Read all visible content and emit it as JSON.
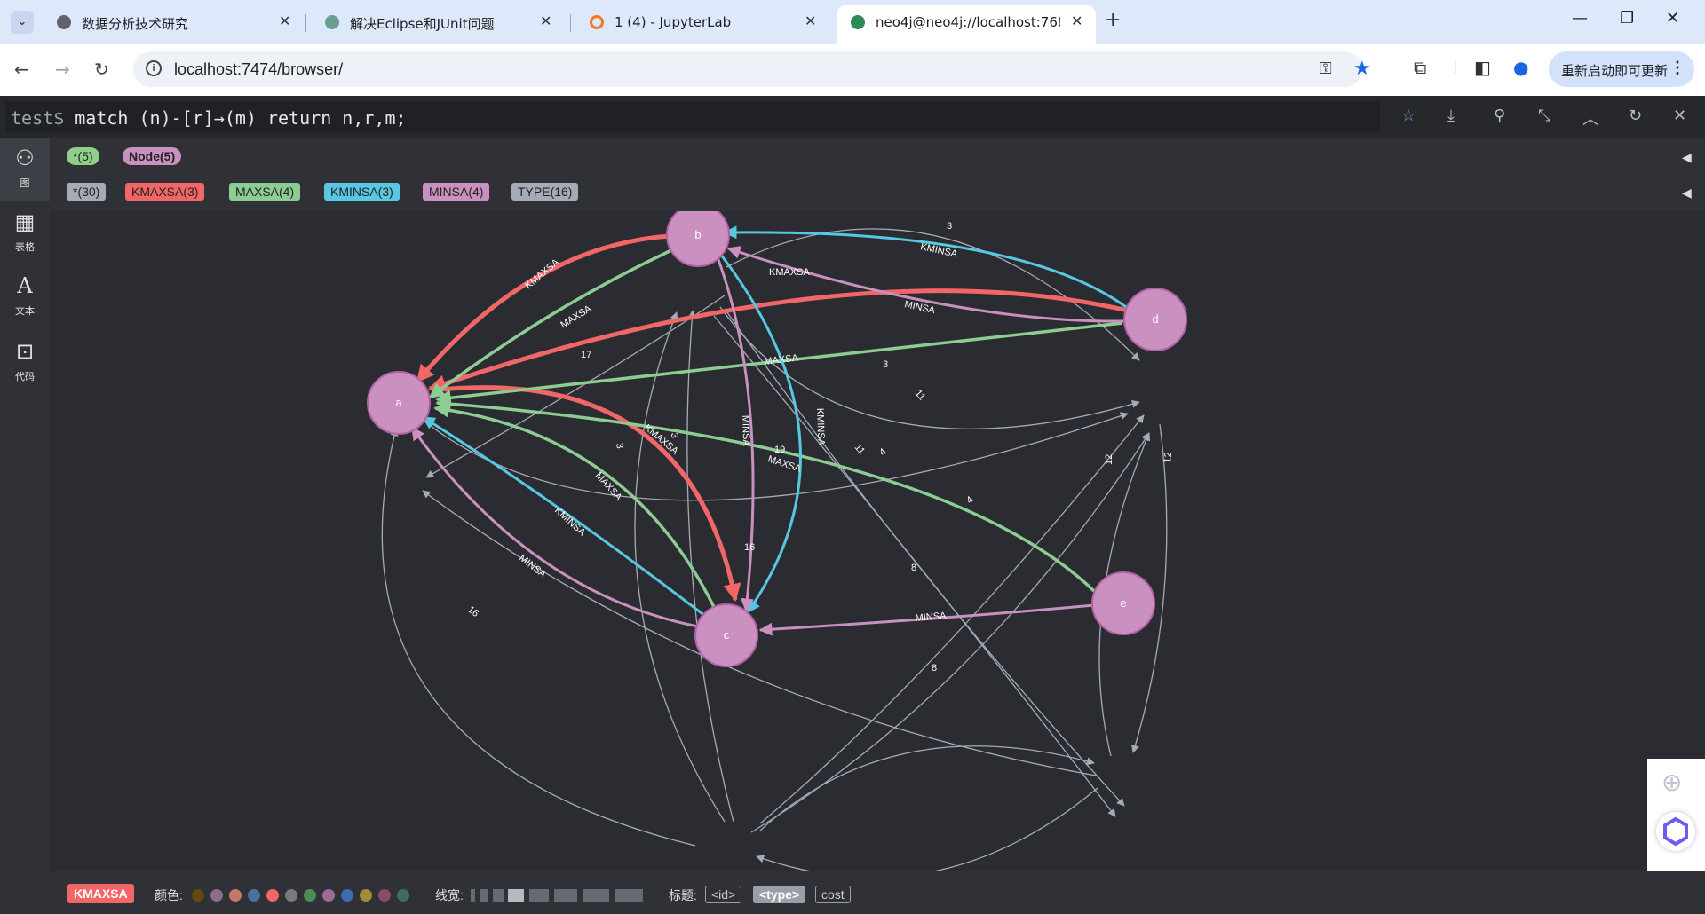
{
  "browser": {
    "tabs": [
      {
        "title": "数据分析技术研究",
        "active": false
      },
      {
        "title": "解决Eclipse和JUnit问题",
        "active": false
      },
      {
        "title": "1 (4) - JupyterLab",
        "active": false
      },
      {
        "title": "neo4j@neo4j://localhost:768",
        "active": true
      }
    ],
    "url": "localhost:7474/browser/",
    "update_button": "重新启动即可更新"
  },
  "editor": {
    "prompt": "test$",
    "query": "match (n)-[r]→(m) return n,r,m;"
  },
  "leftnav": [
    {
      "label": "图",
      "icon": "graph-icon"
    },
    {
      "label": "表格",
      "icon": "table-icon"
    },
    {
      "label": "文本",
      "icon": "text-icon"
    },
    {
      "label": "代码",
      "icon": "code-icon"
    }
  ],
  "legend": {
    "nodes": [
      {
        "label": "*(5)",
        "color": "#8fcf8a"
      },
      {
        "label": "Node(5)",
        "color": "#c990c0"
      }
    ],
    "relationships": [
      {
        "label": "*(30)",
        "color": "#a5abb6"
      },
      {
        "label": "KMAXSA(3)",
        "color": "#f16667"
      },
      {
        "label": "MAXSA(4)",
        "color": "#8dcc93"
      },
      {
        "label": "KMINSA(3)",
        "color": "#57c7e3"
      },
      {
        "label": "MINSA(4)",
        "color": "#c990c0"
      },
      {
        "label": "TYPE(16)",
        "color": "#a5abb6"
      }
    ]
  },
  "graph": {
    "nodes": [
      "a",
      "b",
      "c",
      "d",
      "e"
    ],
    "edges": [
      {
        "from": "b",
        "to": "a",
        "type": "KMAXSA"
      },
      {
        "from": "d",
        "to": "a",
        "type": "KMAXSA"
      },
      {
        "from": "a",
        "to": "c",
        "type": "KMAXSA"
      },
      {
        "from": "b",
        "to": "a",
        "type": "MAXSA"
      },
      {
        "from": "d",
        "to": "a",
        "type": "MAXSA"
      },
      {
        "from": "c",
        "to": "a",
        "type": "MAXSA"
      },
      {
        "from": "e",
        "to": "a",
        "type": "MAXSA"
      },
      {
        "from": "d",
        "to": "b",
        "type": "KMINSA"
      },
      {
        "from": "b",
        "to": "c",
        "type": "KMINSA"
      },
      {
        "from": "c",
        "to": "a",
        "type": "KMINSA"
      },
      {
        "from": "d",
        "to": "b",
        "type": "MINSA"
      },
      {
        "from": "b",
        "to": "c",
        "type": "MINSA"
      },
      {
        "from": "c",
        "to": "a",
        "type": "MINSA"
      },
      {
        "from": "e",
        "to": "c",
        "type": "MINSA"
      },
      {
        "from": "b",
        "to": "d",
        "type": "3"
      },
      {
        "from": "a",
        "to": "b",
        "type": "17"
      },
      {
        "from": "c",
        "to": "b",
        "type": "3"
      },
      {
        "from": "c",
        "to": "b",
        "type": "3"
      },
      {
        "from": "b",
        "to": "d",
        "type": "3"
      },
      {
        "from": "b",
        "to": "e",
        "type": "11"
      },
      {
        "from": "b",
        "to": "e",
        "type": "11"
      },
      {
        "from": "a",
        "to": "d",
        "type": "19"
      },
      {
        "from": "c",
        "to": "d",
        "type": "4"
      },
      {
        "from": "c",
        "to": "d",
        "type": "4"
      },
      {
        "from": "e",
        "to": "d",
        "type": "12"
      },
      {
        "from": "d",
        "to": "e",
        "type": "12"
      },
      {
        "from": "e",
        "to": "a",
        "type": "16"
      },
      {
        "from": "c",
        "to": "a",
        "type": "16"
      },
      {
        "from": "c",
        "to": "e",
        "type": "8"
      },
      {
        "from": "e",
        "to": "c",
        "type": "8"
      }
    ]
  },
  "stylebar": {
    "selected": "KMAXSA",
    "selected_color": "#f16667",
    "color_label": "颜色:",
    "colors": [
      "#604a0e",
      "#8a6d8e",
      "#c4786a",
      "#45739b",
      "#f16667",
      "#7a7a7a",
      "#4f8a5a",
      "#9e6a9a",
      "#3f6ab0",
      "#a38a35",
      "#8c4a6a",
      "#3e6d5a"
    ],
    "width_label": "线宽:",
    "caption_label": "标题:",
    "captions": [
      {
        "label": "<id>",
        "selected": false
      },
      {
        "label": "<type>",
        "selected": true
      },
      {
        "label": "cost",
        "selected": false
      }
    ]
  }
}
